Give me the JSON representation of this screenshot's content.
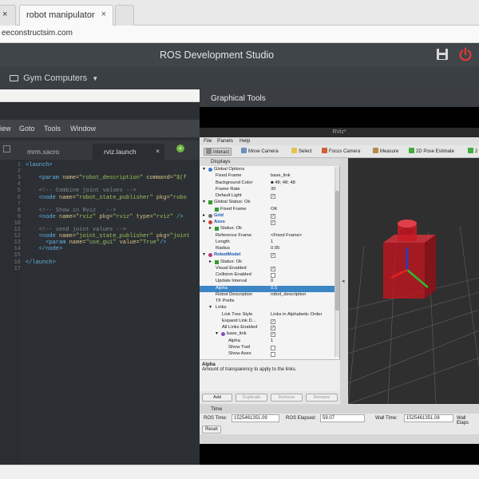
{
  "browser": {
    "tabs": [
      {
        "label": "robot manipulator"
      }
    ],
    "close_glyph": "×",
    "left_close_glyph": "×",
    "url": "eeconstructsim.com"
  },
  "studio": {
    "title": "ROS Development Studio",
    "workspace_menu": "Gym Computers"
  },
  "editor": {
    "menu": [
      "iew",
      "Goto",
      "Tools",
      "Window"
    ],
    "tabs": [
      {
        "label": "mrm.xacro"
      },
      {
        "label": "rviz.launch"
      }
    ],
    "line_numbers": [
      "1",
      "2",
      "3",
      "4",
      "5",
      "6",
      "7",
      "8",
      "9",
      "10",
      "11",
      "12",
      "13",
      "14",
      "15",
      "16",
      "17"
    ],
    "lines": [
      [
        {
          "t": "<launch>",
          "c": "tag"
        }
      ],
      [],
      [
        {
          "t": "    <param ",
          "c": "tag"
        },
        {
          "t": "name=",
          "c": "attr"
        },
        {
          "t": "\"robot_description\" ",
          "c": "str"
        },
        {
          "t": "command=",
          "c": "attr"
        },
        {
          "t": "\"$(f",
          "c": "str"
        }
      ],
      [],
      [
        {
          "t": "    <!-- Combine joint values -->",
          "c": "cm"
        }
      ],
      [
        {
          "t": "    <node ",
          "c": "tag"
        },
        {
          "t": "name=",
          "c": "attr"
        },
        {
          "t": "\"robot_state_publisher\" ",
          "c": "str"
        },
        {
          "t": "pkg=",
          "c": "attr"
        },
        {
          "t": "\"robo",
          "c": "str"
        }
      ],
      [],
      [
        {
          "t": "    <!-- Show in Rviz   -->",
          "c": "cm"
        }
      ],
      [
        {
          "t": "    <node ",
          "c": "tag"
        },
        {
          "t": "name=",
          "c": "attr"
        },
        {
          "t": "\"rviz\" ",
          "c": "str"
        },
        {
          "t": "pkg=",
          "c": "attr"
        },
        {
          "t": "\"rviz\" ",
          "c": "str"
        },
        {
          "t": "type=",
          "c": "attr"
        },
        {
          "t": "\"rviz\" ",
          "c": "str"
        },
        {
          "t": "/>",
          "c": "tag"
        }
      ],
      [],
      [
        {
          "t": "    <!-- send joint values -->",
          "c": "cm"
        }
      ],
      [
        {
          "t": "    <node ",
          "c": "tag"
        },
        {
          "t": "name=",
          "c": "attr"
        },
        {
          "t": "\"joint_state_publisher\" ",
          "c": "str"
        },
        {
          "t": "pkg=",
          "c": "attr"
        },
        {
          "t": "\"joint",
          "c": "str"
        }
      ],
      [
        {
          "t": "      <param ",
          "c": "tag"
        },
        {
          "t": "name=",
          "c": "attr"
        },
        {
          "t": "\"use_gui\" ",
          "c": "str"
        },
        {
          "t": "value=",
          "c": "attr"
        },
        {
          "t": "\"True\"",
          "c": "str"
        },
        {
          "t": "/>",
          "c": "tag"
        }
      ],
      [
        {
          "t": "    </node>",
          "c": "tag"
        }
      ],
      [],
      [
        {
          "t": "</launch>",
          "c": "tag"
        }
      ],
      []
    ]
  },
  "graphical_tools": {
    "title": "Graphical Tools",
    "rviz_title": "RViz*",
    "menu": [
      "File",
      "Panels",
      "Help"
    ],
    "toolbar": [
      "Interact",
      "Move Camera",
      "Select",
      "Focus Camera",
      "Measure",
      "2D Pose Estimate",
      "2"
    ],
    "displays_title": "Displays",
    "properties": [
      {
        "indent": 0,
        "arrow": "▾",
        "icon": "globe",
        "key": "Global Options",
        "value": ""
      },
      {
        "indent": 1,
        "key": "Fixed Frame",
        "value": "base_link"
      },
      {
        "indent": 1,
        "key": "Background Color",
        "value": "■ 48; 48; 48"
      },
      {
        "indent": 1,
        "key": "Frame Rate",
        "value": "30"
      },
      {
        "indent": 1,
        "key": "Default Light",
        "value": "",
        "check": "✓"
      },
      {
        "indent": 0,
        "arrow": "▾",
        "icon": "ok",
        "key": "Global Status: Ok",
        "value": ""
      },
      {
        "indent": 1,
        "icon": "ok",
        "key": "Fixed Frame",
        "value": "OK"
      },
      {
        "indent": 0,
        "arrow": "▸",
        "icon": "grid",
        "key": "Grid",
        "value": "",
        "check": "✓",
        "blue": true
      },
      {
        "indent": 0,
        "arrow": "▾",
        "icon": "axes",
        "key": "Axes",
        "value": "",
        "check": "✓",
        "blue": true
      },
      {
        "indent": 1,
        "arrow": "▸",
        "icon": "ok",
        "key": "Status: Ok",
        "value": ""
      },
      {
        "indent": 1,
        "key": "Reference Frame",
        "value": "<Fixed Frame>"
      },
      {
        "indent": 1,
        "key": "Length",
        "value": "1"
      },
      {
        "indent": 1,
        "key": "Radius",
        "value": "0.05"
      },
      {
        "indent": 0,
        "arrow": "▾",
        "icon": "robot",
        "key": "RobotModel",
        "value": "",
        "check": "✓",
        "blue": true
      },
      {
        "indent": 1,
        "arrow": "▸",
        "icon": "ok",
        "key": "Status: Ok",
        "value": ""
      },
      {
        "indent": 1,
        "key": "Visual Enabled",
        "value": "",
        "check": "✓"
      },
      {
        "indent": 1,
        "key": "Collision Enabled",
        "value": "",
        "check": " "
      },
      {
        "indent": 1,
        "key": "Update Interval",
        "value": "0"
      },
      {
        "indent": 1,
        "key": "Alpha",
        "value": "0.5",
        "selected": true
      },
      {
        "indent": 1,
        "key": "Robot Description",
        "value": "robot_description"
      },
      {
        "indent": 1,
        "key": "TF Prefix",
        "value": ""
      },
      {
        "indent": 1,
        "arrow": "▾",
        "key": "Links",
        "value": ""
      },
      {
        "indent": 2,
        "key": "Link Tree Style",
        "value": "Links in Alphabetic Order"
      },
      {
        "indent": 2,
        "key": "Expand Link D...",
        "value": "",
        "check": "✓"
      },
      {
        "indent": 2,
        "key": "All Links Enabled",
        "value": "",
        "check": "✓"
      },
      {
        "indent": 2,
        "arrow": "▾",
        "icon": "link",
        "key": "base_link",
        "value": "",
        "check": "✓"
      },
      {
        "indent": 3,
        "key": "Alpha",
        "value": "1"
      },
      {
        "indent": 3,
        "key": "Show Trail",
        "value": "",
        "check": " "
      },
      {
        "indent": 3,
        "key": "Show Axes",
        "value": "",
        "check": " "
      }
    ],
    "description": {
      "title": "Alpha",
      "text": "Amount of transparency to apply to the links."
    },
    "buttons": [
      "Add",
      "Duplicate",
      "Remove",
      "Rename"
    ],
    "time": {
      "title": "Time",
      "ros_time_label": "ROS Time:",
      "ros_time": "1525461351.09",
      "ros_elapsed_label": "ROS Elapsed:",
      "ros_elapsed": "59.07",
      "wall_time_label": "Wall Time:",
      "wall_time": "1525461351.08",
      "wall_elapsed_label": "Wall Elaps",
      "reset": "Reset"
    }
  },
  "colors": {
    "accent_red": "#e53935",
    "selection_blue": "#3d86c6",
    "viewport_bg": "#303030",
    "robot_red": "#c4141f"
  }
}
